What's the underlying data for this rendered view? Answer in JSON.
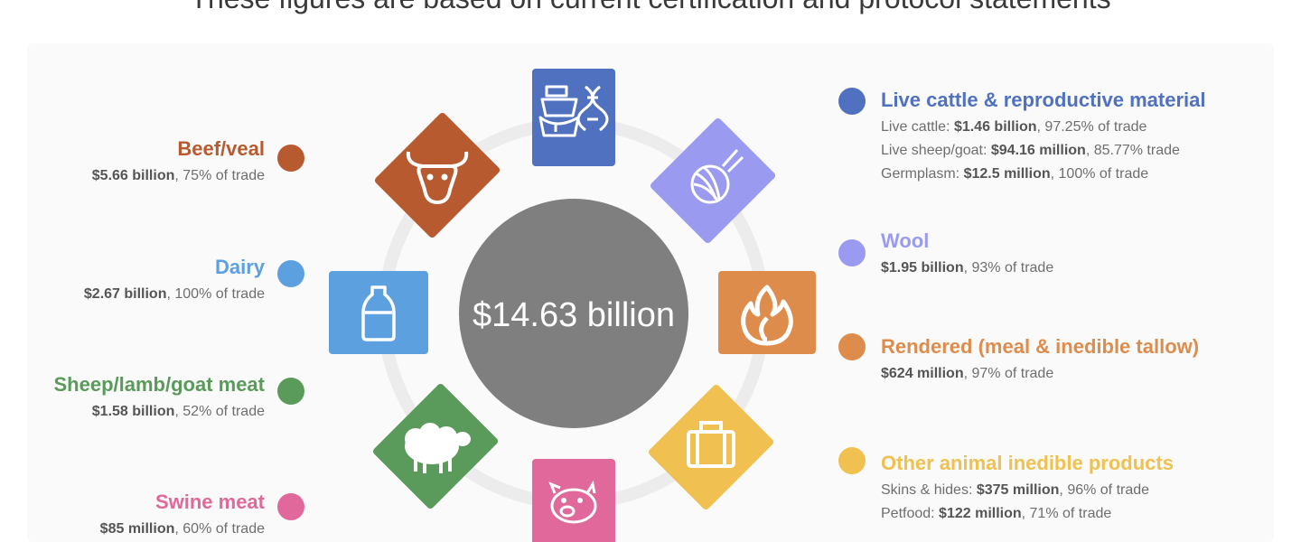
{
  "header": "These figures are based on current certification and protocol statements",
  "center": "$14.63 billion",
  "colors": {
    "beef": "#b85a30",
    "dairy": "#5ca0e0",
    "sheep": "#5a9a5a",
    "swine": "#e0689a",
    "cattle": "#5070c0",
    "wool": "#9a9af0",
    "rendered": "#de8c4c",
    "other": "#f0c050",
    "hub": "#7f7f7f",
    "ring": "#eeeeee"
  },
  "left": [
    {
      "key": "beef",
      "title": "Beef/veal",
      "lines": [
        {
          "value": "$5.66 billion",
          "rest": ", 75% of trade"
        }
      ]
    },
    {
      "key": "dairy",
      "title": "Dairy",
      "lines": [
        {
          "value": "$2.67 billion",
          "rest": ", 100% of trade"
        }
      ]
    },
    {
      "key": "sheep",
      "title": "Sheep/lamb/goat meat",
      "lines": [
        {
          "value": "$1.58 billion",
          "rest": ", 52% of trade"
        }
      ]
    },
    {
      "key": "swine",
      "title": "Swine meat",
      "lines": [
        {
          "value": "$85 million",
          "rest": ", 60% of trade"
        }
      ]
    }
  ],
  "right": [
    {
      "key": "cattle",
      "title": "Live cattle & reproductive material",
      "lines": [
        {
          "label": "Live cattle: ",
          "value": "$1.46 billion",
          "rest": ", 97.25% of trade"
        },
        {
          "label": "Live sheep/goat: ",
          "value": "$94.16 million",
          "rest": ", 85.77% trade"
        },
        {
          "label": "Germplasm: ",
          "value": "$12.5 million",
          "rest": ", 100% of trade"
        }
      ]
    },
    {
      "key": "wool",
      "title": "Wool",
      "lines": [
        {
          "value": "$1.95 billion",
          "rest": ", 93% of trade"
        }
      ]
    },
    {
      "key": "rendered",
      "title": "Rendered (meal & inedible tallow)",
      "lines": [
        {
          "value": "$624 million",
          "rest": ", 97% of trade"
        }
      ]
    },
    {
      "key": "other",
      "title": "Other animal inedible products",
      "lines": [
        {
          "label": "Skins & hides: ",
          "value": "$375 million",
          "rest": ", 96% of trade"
        },
        {
          "label": "Petfood: ",
          "value": "$122 million",
          "rest": ", 71% of trade"
        }
      ]
    }
  ],
  "icons": {
    "cattle": "ship-dna-icon",
    "wool": "yarn-ball-icon",
    "rendered": "flame-icon",
    "other": "suitcase-icon",
    "swine": "pig-icon",
    "sheep": "sheep-icon",
    "dairy": "milk-bottle-icon",
    "beef": "cow-head-icon"
  }
}
